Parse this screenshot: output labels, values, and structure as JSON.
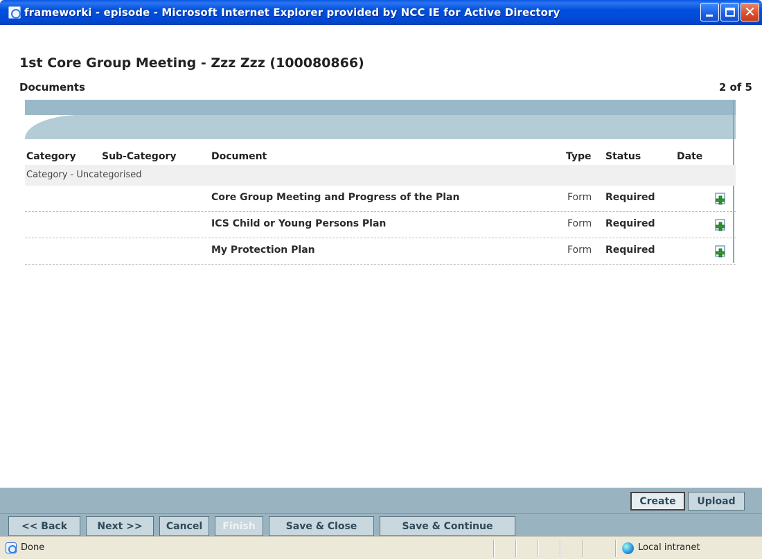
{
  "window": {
    "title": "frameworki - episode - Microsoft Internet Explorer provided by NCC IE for Active Directory",
    "controls": [
      "minimize-icon",
      "maximize-icon",
      "close-icon"
    ],
    "accent_color": "#0054e3"
  },
  "page": {
    "title": "1st Core Group Meeting - Zzz Zzz (100080866)",
    "section": "Documents",
    "page_count": "2 of 5"
  },
  "table": {
    "columns": {
      "category": "Category",
      "sub_category": "Sub-Category",
      "document": "Document",
      "type": "Type",
      "status": "Status",
      "date": "Date"
    },
    "group_label": "Category - Uncategorised",
    "rows": [
      {
        "document": "Core Group Meeting and Progress of the Plan",
        "type": "Form",
        "status": "Required",
        "action_icon": "add-document-icon"
      },
      {
        "document": "ICS Child or Young Persons Plan",
        "type": "Form",
        "status": "Required",
        "action_icon": "add-document-icon"
      },
      {
        "document": "My Protection Plan",
        "type": "Form",
        "status": "Required",
        "action_icon": "add-document-icon"
      }
    ]
  },
  "actions": {
    "create": "Create",
    "upload": "Upload"
  },
  "nav": {
    "back": "<< Back",
    "next": "Next >>",
    "cancel": "Cancel",
    "finish": "Finish",
    "save_close": "Save & Close",
    "save_continue": "Save & Continue"
  },
  "statusbar": {
    "status": "Done",
    "zone": "Local intranet"
  }
}
